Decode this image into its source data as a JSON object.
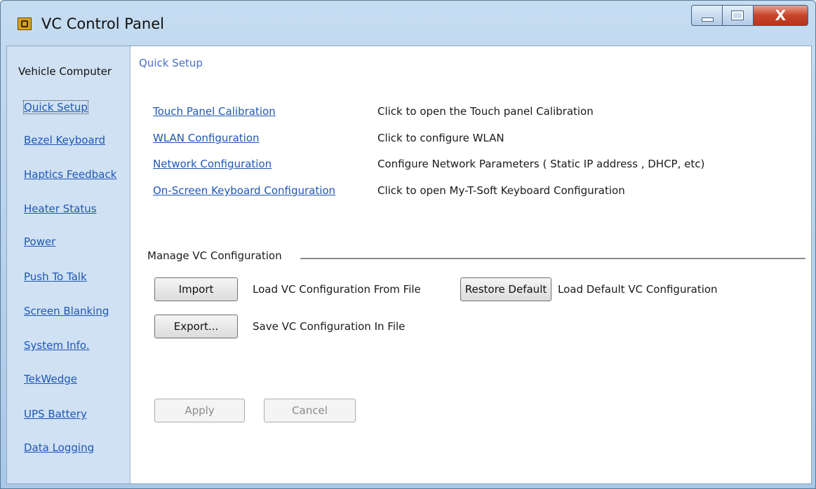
{
  "window": {
    "title": "VC Control Panel",
    "icon": "vc-app-icon",
    "close_glyph": "X"
  },
  "sidebar": {
    "header": "Vehicle Computer",
    "items": [
      {
        "label": "Quick Setup",
        "active": true
      },
      {
        "label": "Bezel Keyboard"
      },
      {
        "label": "Haptics Feedback"
      },
      {
        "label": "Heater Status"
      },
      {
        "label": "Power"
      },
      {
        "label": "Push To Talk"
      },
      {
        "label": "Screen Blanking"
      },
      {
        "label": "System Info."
      },
      {
        "label": "TekWedge"
      },
      {
        "label": "UPS Battery"
      },
      {
        "label": "Data Logging"
      }
    ]
  },
  "main": {
    "section_title": "Quick Setup",
    "links": [
      {
        "label": "Touch Panel Calibration",
        "description": "Click to open the Touch panel Calibration"
      },
      {
        "label": "WLAN Configuration",
        "description": "Click to configure WLAN"
      },
      {
        "label": "Network Configuration",
        "description": "Configure Network Parameters ( Static IP address , DHCP, etc)"
      },
      {
        "label": "On-Screen Keyboard Configuration",
        "description": "Click to open My-T-Soft Keyboard Configuration"
      }
    ],
    "manage": {
      "title": "Manage VC Configuration",
      "import_label": "Import",
      "import_desc": "Load VC Configuration From File",
      "restore_label": "Restore Default",
      "restore_desc": "Load Default VC Configuration",
      "export_label": "Export...",
      "export_desc": "Save VC Configuration In File"
    },
    "apply_label": "Apply",
    "cancel_label": "Cancel"
  }
}
